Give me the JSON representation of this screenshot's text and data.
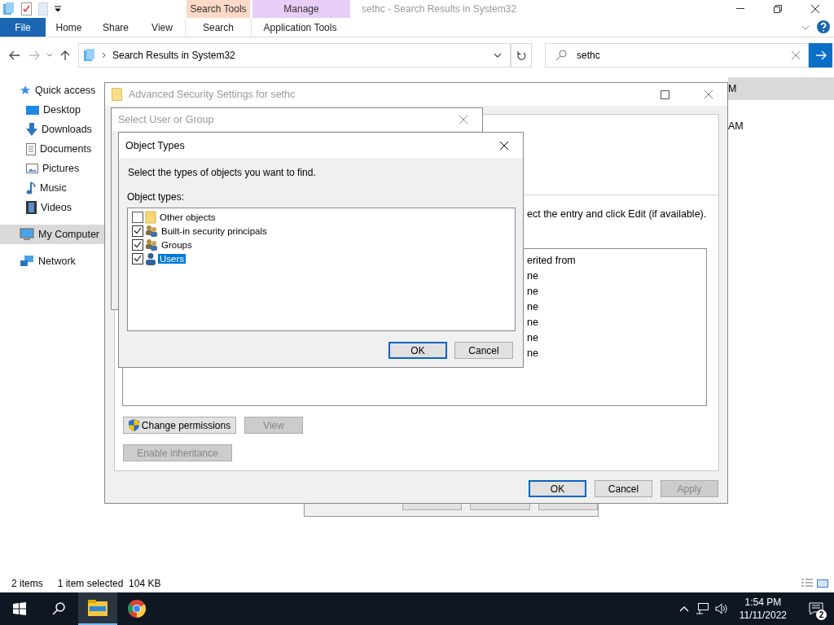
{
  "explorer": {
    "title": "sethc - Search Results in System32",
    "contextual_tabs": [
      {
        "label": "Search Tools",
        "color": "#fcd9c6"
      },
      {
        "label": "Manage",
        "color": "#e8cdf7"
      }
    ],
    "ribbon_tabs": [
      {
        "label": "File",
        "kind": "file"
      },
      {
        "label": "Home",
        "kind": "tab"
      },
      {
        "label": "Share",
        "kind": "tab"
      },
      {
        "label": "View",
        "kind": "tab"
      },
      {
        "label": "Search",
        "kind": "contextual"
      },
      {
        "label": "Application Tools",
        "kind": "contextual"
      }
    ],
    "address": {
      "path": "Search Results in System32"
    },
    "search": {
      "value": "sethc"
    },
    "sidebar": {
      "items": [
        {
          "label": "Quick access",
          "kind": "star",
          "selected": false,
          "children": [
            {
              "label": "Desktop",
              "kind": "desktop",
              "selected": false
            },
            {
              "label": "Downloads",
              "kind": "download",
              "selected": false
            },
            {
              "label": "Documents",
              "kind": "document",
              "selected": false
            },
            {
              "label": "Pictures",
              "kind": "picture",
              "selected": false
            },
            {
              "label": "Music",
              "kind": "music",
              "selected": false
            },
            {
              "label": "Videos",
              "kind": "video",
              "selected": false
            }
          ]
        },
        {
          "label": "My Computer",
          "kind": "computer",
          "selected": true
        },
        {
          "label": "Network",
          "kind": "network",
          "selected": false
        }
      ]
    },
    "list_rows": [
      {
        "text": "M",
        "selected": true
      },
      {
        "text": "AM",
        "selected": false
      }
    ],
    "status_bar": {
      "items": "2 items",
      "selection": "1 item selected  104 KB"
    }
  },
  "advanced_dialog": {
    "title": "Advanced Security Settings for sethc",
    "instruction": "ect the entry and click Edit (if available).",
    "column_header": "erited from",
    "column_cells": [
      "ne",
      "ne",
      "ne",
      "ne",
      "ne",
      "ne"
    ],
    "buttons": [
      {
        "label": "Change permissions",
        "kind": "shield",
        "disabled": false
      },
      {
        "label": "View",
        "kind": "plain",
        "disabled": true
      },
      {
        "label": "Enable inheritance",
        "kind": "plain",
        "disabled": true
      }
    ],
    "footer_buttons": [
      {
        "label": "OK",
        "default": true,
        "disabled": false
      },
      {
        "label": "Cancel",
        "default": false,
        "disabled": false
      },
      {
        "label": "Apply",
        "default": false,
        "disabled": true
      }
    ]
  },
  "select_dialog": {
    "title": "Select User or Group"
  },
  "object_types_dialog": {
    "title": "Object Types",
    "prompt": "Select the types of objects you want to find.",
    "list_label": "Object types:",
    "items": [
      {
        "label": "Other objects",
        "kind": "folder",
        "checked": false,
        "selected": false
      },
      {
        "label": "Built-in security principals",
        "kind": "group",
        "checked": true,
        "selected": false
      },
      {
        "label": "Groups",
        "kind": "group",
        "checked": true,
        "selected": false
      },
      {
        "label": "Users",
        "kind": "user",
        "checked": true,
        "selected": true
      }
    ],
    "buttons": [
      {
        "label": "OK",
        "default": true
      },
      {
        "label": "Cancel",
        "default": false
      }
    ]
  },
  "taskbar": {
    "apps": [
      {
        "kind": "explorer",
        "active": true
      },
      {
        "kind": "chrome",
        "active": false
      }
    ],
    "time": "1:54 PM",
    "date": "11/11/2022",
    "notifications": "2"
  }
}
